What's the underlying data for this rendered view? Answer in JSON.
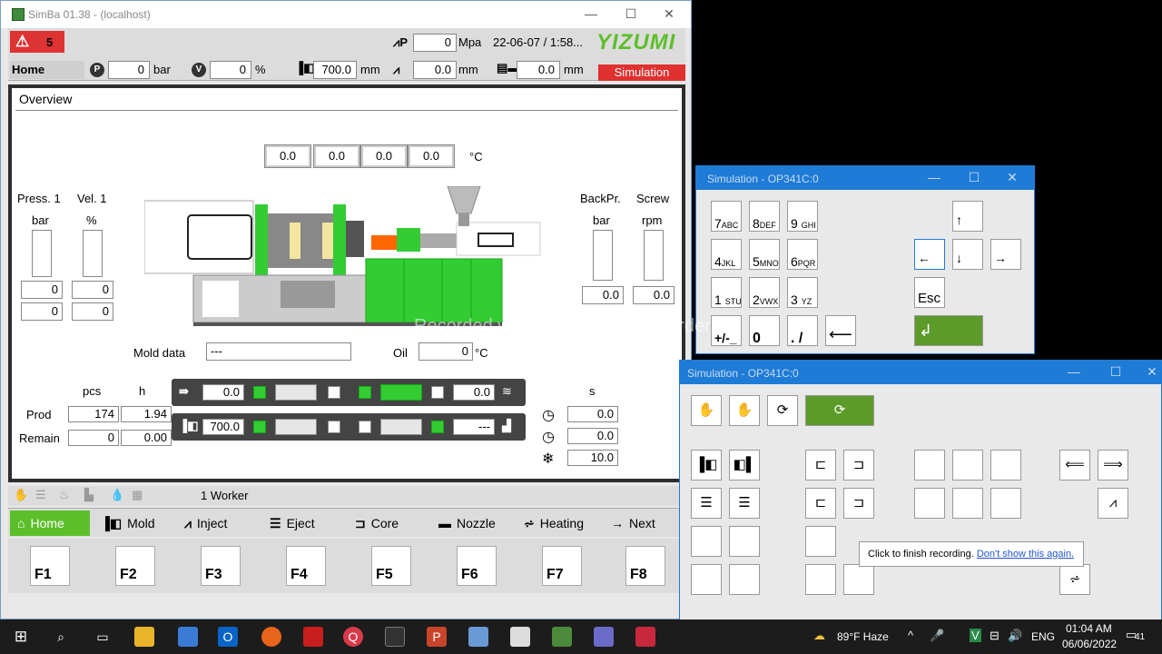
{
  "main_window": {
    "title": "SimBa 01.38 - (localhost)",
    "alarm_count": "5",
    "header": {
      "home": "Home",
      "pressure_value": "0",
      "pressure_unit": "bar",
      "velocity_value": "0",
      "velocity_unit": "%",
      "position_value": "700.0",
      "position_unit": "mm",
      "mpa_value": "0",
      "mpa_unit": "Mpa",
      "datetime": "22-06-07 / 1:58...",
      "screw_pos_value": "0.0",
      "screw_pos_unit": "mm",
      "eject_pos_value": "0.0",
      "eject_pos_unit": "mm",
      "brand": "YIZUMI",
      "mode_badge": "Simulation"
    },
    "overview": {
      "title": "Overview",
      "temps": [
        "0.0",
        "0.0",
        "0.0",
        "0.0"
      ],
      "temp_unit": "°C",
      "press_label": "Press. 1",
      "press_unit": "bar",
      "vel_label": "Vel. 1",
      "vel_unit": "%",
      "press_vals": [
        "0",
        "0"
      ],
      "vel_vals": [
        "0",
        "0"
      ],
      "backpr_label": "BackPr.",
      "backpr_unit": "bar",
      "backpr_value": "0.0",
      "screw_label": "Screw",
      "screw_unit": "rpm",
      "screw_value": "0.0",
      "mold_data_label": "Mold data",
      "mold_data_value": "---",
      "oil_label": "Oil",
      "oil_value": "0",
      "oil_unit": "°C",
      "pcs_label": "pcs",
      "h_label": "h",
      "prod_label": "Prod",
      "prod_pcs": "174",
      "prod_h": "1.94",
      "remain_label": "Remain",
      "remain_pcs": "0",
      "remain_h": "0.00",
      "inject_row_value": "0.0",
      "inject_row_end": "0.0",
      "clamp_row_value": "700.0",
      "clamp_row_end": "---",
      "s_label": "s",
      "timer_1": "0.0",
      "timer_2": "0.0",
      "cooling": "10.0"
    },
    "worker_text": "1 Worker",
    "tabs": [
      "Home",
      "Mold",
      "Inject",
      "Eject",
      "Core",
      "Nozzle",
      "Heating",
      "Next"
    ],
    "fkeys": [
      "F1",
      "F2",
      "F3",
      "F4",
      "F5",
      "F6",
      "F7",
      "F8"
    ]
  },
  "keypad_window": {
    "title": "Simulation - OP341C:0",
    "keys": [
      {
        "n": "7",
        "s": "ABC"
      },
      {
        "n": "8",
        "s": "DEF"
      },
      {
        "n": "9",
        "s": "GHI"
      },
      {
        "n": "4",
        "s": "JKL"
      },
      {
        "n": "5",
        "s": "MNO"
      },
      {
        "n": "6",
        "s": "PQR"
      },
      {
        "n": "1",
        "s": "STU"
      },
      {
        "n": "2",
        "s": "VWX"
      },
      {
        "n": "3",
        "s": "YZ"
      }
    ],
    "sign_key": "+/-_",
    "zero_key": "0",
    "dot_key": ". /",
    "esc_key": "Esc"
  },
  "sim_window": {
    "title": "Simulation - OP341C:0"
  },
  "tooltip": {
    "text": "Click to finish recording.",
    "link": "Don't show this again."
  },
  "watermark": "Recorded with iTop Screen Recorder",
  "taskbar": {
    "weather": "89°F  Haze",
    "lang": "ENG",
    "time": "01:04 AM",
    "date": "06/06/2022",
    "notif_count": "41"
  },
  "colors": {
    "accent_green": "#5cbf2a",
    "alarm_red": "#d33333",
    "title_blue": "#1e7bd6"
  }
}
